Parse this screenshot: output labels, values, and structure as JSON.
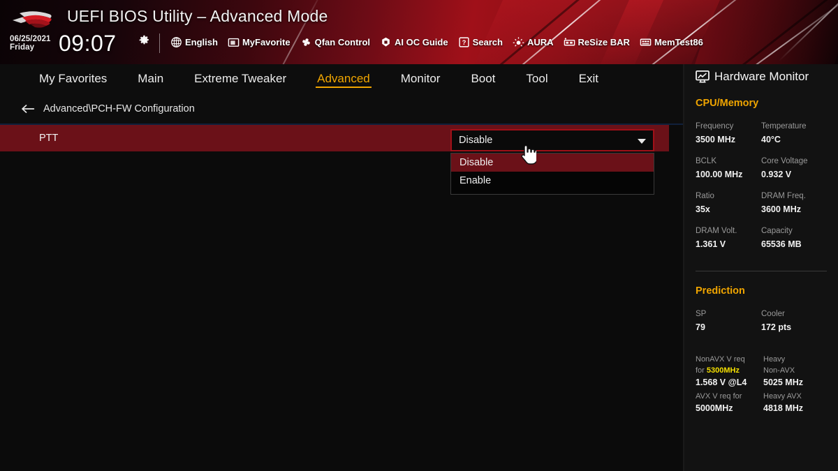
{
  "header": {
    "title": "UEFI BIOS Utility – Advanced Mode",
    "logo_icon": "rog-eye-logo",
    "date": "06/25/2021",
    "weekday": "Friday",
    "time": "09:07",
    "gear_icon": "gear-icon",
    "toolbar": [
      {
        "label": "English",
        "icon": "globe-icon"
      },
      {
        "label": "MyFavorite",
        "icon": "folder-icon"
      },
      {
        "label": "Qfan Control",
        "icon": "fan-icon"
      },
      {
        "label": "AI OC Guide",
        "icon": "chip-icon"
      },
      {
        "label": "Search",
        "icon": "question-box-icon"
      },
      {
        "label": "AURA",
        "icon": "lightbulb-icon"
      },
      {
        "label": "ReSize BAR",
        "icon": "memory-icon"
      },
      {
        "label": "MemTest86",
        "icon": "memtest-icon"
      }
    ]
  },
  "tabs": [
    {
      "label": "My Favorites",
      "active": false
    },
    {
      "label": "Main",
      "active": false
    },
    {
      "label": "Extreme Tweaker",
      "active": false
    },
    {
      "label": "Advanced",
      "active": true
    },
    {
      "label": "Monitor",
      "active": false
    },
    {
      "label": "Boot",
      "active": false
    },
    {
      "label": "Tool",
      "active": false
    },
    {
      "label": "Exit",
      "active": false
    }
  ],
  "breadcrumb": {
    "back_icon": "back-arrow-icon",
    "path": "Advanced\\PCH-FW Configuration"
  },
  "main": {
    "option_label": "PTT",
    "select_value": "Disable",
    "caret_icon": "chevron-down-icon",
    "dropdown_options": [
      {
        "label": "Disable",
        "selected": true
      },
      {
        "label": "Enable",
        "selected": false
      }
    ],
    "cursor_icon": "hand-pointer-cursor"
  },
  "sidebar": {
    "icon": "hardware-monitor-icon",
    "title": "Hardware Monitor",
    "sections": [
      {
        "title": "CPU/Memory",
        "entries": [
          {
            "key": "Frequency",
            "value": "3500 MHz"
          },
          {
            "key": "Temperature",
            "value": "40°C"
          },
          {
            "key": "BCLK",
            "value": "100.00 MHz"
          },
          {
            "key": "Core Voltage",
            "value": "0.932 V"
          },
          {
            "key": "Ratio",
            "value": "35x"
          },
          {
            "key": "DRAM Freq.",
            "value": "3600 MHz"
          },
          {
            "key": "DRAM Volt.",
            "value": "1.361 V"
          },
          {
            "key": "Capacity",
            "value": "65536 MB"
          }
        ]
      },
      {
        "title": "Prediction",
        "entries": [
          {
            "key": "SP",
            "value": "79"
          },
          {
            "key": "Cooler",
            "value": "172 pts"
          }
        ]
      }
    ],
    "avx": {
      "nonavx_key_line1": "NonAVX V req",
      "nonavx_key_line2_prefix": "for ",
      "nonavx_freq": "5300MHz",
      "nonavx_value": "1.568 V @L4",
      "heavy_nonavx_key_line1": "Heavy",
      "heavy_nonavx_key_line2": "Non-AVX",
      "heavy_nonavx_value": "5025 MHz",
      "avx_key": "AVX V req   for",
      "avx_freq": "5000MHz",
      "heavy_avx_key": "Heavy AVX",
      "heavy_avx_value": "4818 MHz"
    }
  },
  "colors": {
    "accent_orange": "#f0a500",
    "accent_yellow": "#f5e000",
    "row_maroon": "#6b1118",
    "brand_red": "#a01019"
  }
}
